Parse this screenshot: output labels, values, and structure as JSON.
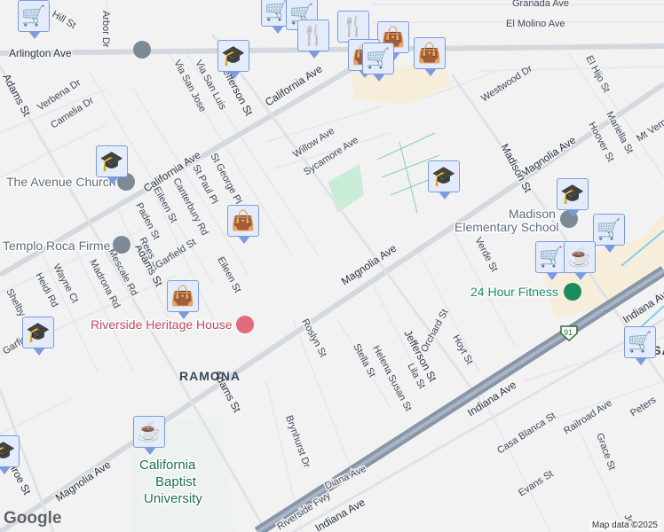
{
  "streets": {
    "arlington": "Arlington Ave",
    "california1": "California Ave",
    "california2": "California Ave",
    "magnolia1": "Magnolia Ave",
    "magnolia2": "Magnolia Ave",
    "magnolia3": "Magnolia Ave",
    "adams1": "Adams St",
    "adams2": "Adams St",
    "adams3": "Adams St",
    "jefferson1": "Jefferson St",
    "jefferson2": "Jefferson St",
    "madison": "Madison St",
    "granada": "Granada Ave",
    "elmolino": "El Molino Ave",
    "westwood": "Westwood Dr",
    "elhijo": "El Hijo St",
    "hoover": "Hoover St",
    "mariella": "Mariella St",
    "mtvernon": "Mt Vernon",
    "verbena": "Verbena Dr",
    "camelia": "Camelia Dr",
    "arbor": "Arbor Dr",
    "hill": "Hill St",
    "viasanjose": "Via San Jose",
    "viasanluis": "Via San Luis",
    "willow": "Willow Ave",
    "sycamore": "Sycamore Ave",
    "stgeorge": "St George Pl",
    "stpaul": "St Paul Pl",
    "canterbury": "Canterbury Rd",
    "eileen1": "Eileen St",
    "eileen2": "Eileen St",
    "paden": "Paden St",
    "rees": "Rees St",
    "garfield1": "Garfield St",
    "garfield2": "Garfield St",
    "mescale": "Mescale Rd",
    "madrona": "Madrona Rd",
    "wayne": "Wayne Ct",
    "heidi": "Heidi Rd",
    "shelby": "Shelby Dr",
    "monroe": "Monroe St",
    "roslyn": "Roslyn St",
    "brynhurst": "Brynhurst Dr",
    "diana": "Diana Ave",
    "stella": "Stella St",
    "helena": "Helena Ave",
    "susan": "Susan St",
    "lila": "Lila St",
    "orchard": "Orchard St",
    "hoyt": "Hoyt St",
    "verde": "Verde St",
    "indiana1": "Indiana Ave",
    "indiana2": "Indiana Ave",
    "indiana3": "Indiana Ave",
    "casablanca": "Casa Blanca St",
    "railroad": "Railroad Ave",
    "evans": "Evans St",
    "grace": "Grace St",
    "peters": "Peters",
    "fwy": "Riverside Fwy",
    "shield": "91",
    "jeff3": "Jeff"
  },
  "places": {
    "avenue_church": "The Avenue Church",
    "templo": "Templo Roca Firme",
    "heritage": "Riverside Heritage House",
    "madison_school_1": "Madison",
    "madison_school_2": "Elementary School",
    "fitness": "24 Hour Fitness",
    "univ1": "California",
    "univ2": "Baptist",
    "univ3": "University"
  },
  "areas": {
    "ramona": "RAMONA",
    "casa_blanca": "CASA B"
  },
  "footer": {
    "logo": "Google",
    "attribution": "Map data ©2025"
  }
}
